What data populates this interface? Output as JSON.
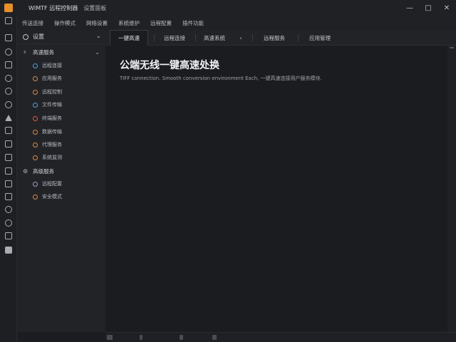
{
  "window": {
    "title": "WIMTF 远程控制器",
    "subtitle": "设置面板",
    "controls": {
      "minimize": "—",
      "maximize": "□",
      "close": "✕"
    }
  },
  "menu": {
    "items": [
      "传送连接",
      "操作模式",
      "网络设置",
      "系统维护",
      "远程配置",
      "插件功能"
    ]
  },
  "leftbar": {
    "icons": [
      "server-icon",
      "database-icon",
      "cloud-icon",
      "file-icon",
      "target-icon",
      "lock-icon",
      "settings-icon",
      "alert-icon",
      "terminal-icon",
      "monitor-icon",
      "image-icon",
      "code-icon",
      "layers-icon",
      "shield-icon",
      "refresh-icon",
      "share-icon",
      "save-icon"
    ]
  },
  "sidebar": {
    "header": "设置",
    "groups": [
      {
        "label": "高速服务",
        "items": [
          {
            "label": "远程连接",
            "color": "#4aa3df"
          },
          {
            "label": "应用服务",
            "color": "#e08a3c"
          },
          {
            "label": "远程控制",
            "color": "#e08a3c"
          },
          {
            "label": "文件传输",
            "color": "#4aa3df"
          },
          {
            "label": "终端服务",
            "color": "#e0573c"
          },
          {
            "label": "数据传输",
            "color": "#e08a3c"
          },
          {
            "label": "代理服务",
            "color": "#e08a3c"
          },
          {
            "label": "系统监测",
            "color": "#e08a3c"
          }
        ]
      },
      {
        "label": "高级服务",
        "items": [
          {
            "label": "远程配置",
            "color": "#9aa3c8"
          },
          {
            "label": "安全模式",
            "color": "#e08a3c"
          }
        ]
      }
    ]
  },
  "tabs": [
    "一键高速",
    "远程连接",
    "高速系统",
    "远程服务",
    "应用管理"
  ],
  "tab_back": "‹",
  "content": {
    "title": "公端无线一键高速处换",
    "description": "TIFF connection. Smooth conversion environment Each, 一键高速连接用户服务模块."
  }
}
